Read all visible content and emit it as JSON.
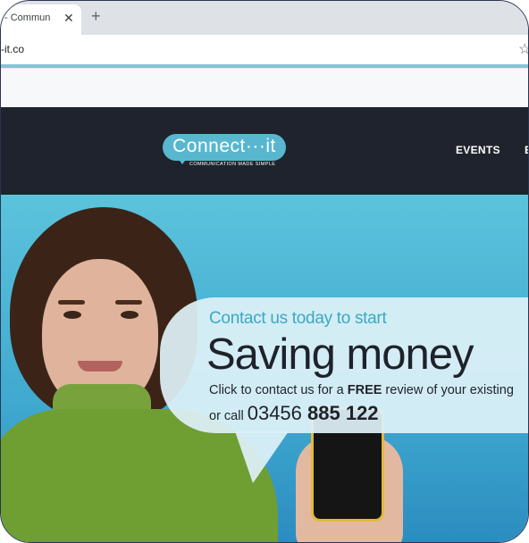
{
  "browser": {
    "tab_title": "- Commun",
    "tab_close": "✕",
    "new_tab": "+",
    "url": "-it.co",
    "star": "☆"
  },
  "site": {
    "logo_text": "Connect···it",
    "logo_tagline": "COMMUNICATION MADE SIMPLE",
    "nav": {
      "events": "EVENTS",
      "next": "E"
    }
  },
  "hero": {
    "lead": "Contact us today to start",
    "headline": "Saving money",
    "line1_pre": "Click to contact us for a ",
    "line1_bold": "FREE",
    "line1_post": " review of your existing",
    "call_pre": "or call ",
    "phone_part1": "03456 ",
    "phone_part2": "885 122"
  },
  "colors": {
    "nav_bg": "#1f232d",
    "accent": "#58b7cf",
    "hero_bg": "#5cc3dc"
  }
}
